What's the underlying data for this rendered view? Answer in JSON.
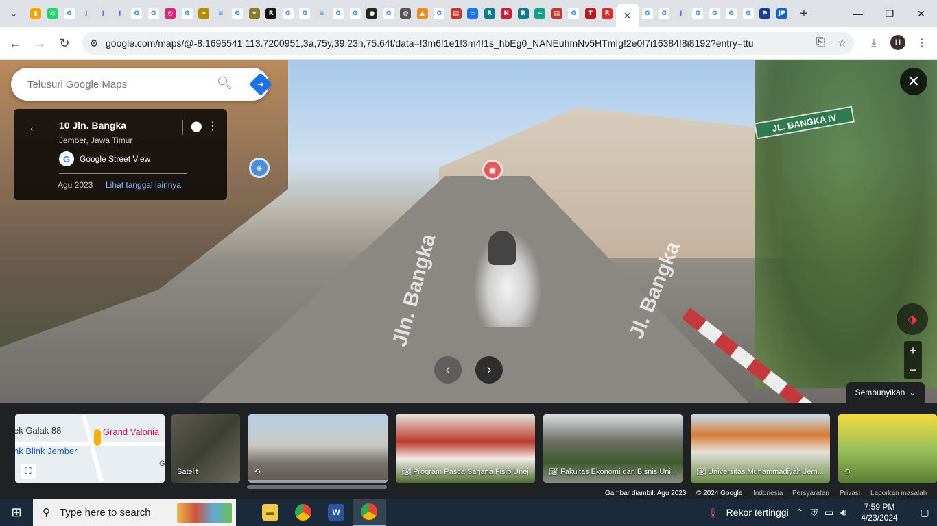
{
  "browser": {
    "active_tab_close": "✕",
    "new_tab": "+",
    "url": "google.com/maps/@-8.1695541,113.7200951,3a,75y,39.23h,75.64t/data=!3m6!1e1!3m4!1s_hbEg0_NANEuhmNv5HTmIg!2e0!7i16384!8i8192?entry=ttu",
    "profile_initial": "H",
    "tabs": [
      {
        "icon": "chart-favicon",
        "color": "#f4a300",
        "glyph": "▮"
      },
      {
        "icon": "whatsapp-favicon",
        "color": "#25d366",
        "glyph": "☏"
      },
      {
        "icon": "google-favicon",
        "color": "#ffffff",
        "glyph": "G"
      },
      {
        "icon": "jdih-favicon",
        "color": "#e0e0e0",
        "glyph": "J"
      },
      {
        "icon": "jdih-favicon",
        "color": "#e0e0e0",
        "glyph": "J"
      },
      {
        "icon": "jdih-favicon",
        "color": "#e0e0e0",
        "glyph": "J"
      },
      {
        "icon": "google-favicon",
        "color": "#ffffff",
        "glyph": "G"
      },
      {
        "icon": "google-favicon",
        "color": "#ffffff",
        "glyph": "G"
      },
      {
        "icon": "instagram-favicon",
        "color": "#d62976",
        "glyph": "◎"
      },
      {
        "icon": "google-favicon",
        "color": "#ffffff",
        "glyph": "G"
      },
      {
        "icon": "emblem-favicon",
        "color": "#b58b00",
        "glyph": "✦"
      },
      {
        "icon": "doc-favicon",
        "color": "#e0e0e0",
        "glyph": "≡"
      },
      {
        "icon": "google-favicon",
        "color": "#ffffff",
        "glyph": "G"
      },
      {
        "icon": "emblem-favicon",
        "color": "#8a7a2a",
        "glyph": "✦"
      },
      {
        "icon": "ro-favicon",
        "color": "#111111",
        "glyph": "R"
      },
      {
        "icon": "google-favicon",
        "color": "#ffffff",
        "glyph": "G"
      },
      {
        "icon": "google-favicon",
        "color": "#ffffff",
        "glyph": "G"
      },
      {
        "icon": "doc-favicon",
        "color": "#e0e0e0",
        "glyph": "≡"
      },
      {
        "icon": "google-favicon",
        "color": "#ffffff",
        "glyph": "G"
      },
      {
        "icon": "google-favicon",
        "color": "#ffffff",
        "glyph": "G"
      },
      {
        "icon": "red-circle-favicon",
        "color": "#222222",
        "glyph": "●"
      },
      {
        "icon": "google-favicon",
        "color": "#ffffff",
        "glyph": "G"
      },
      {
        "icon": "globe-favicon",
        "color": "#555555",
        "glyph": "◍"
      },
      {
        "icon": "orange-favicon",
        "color": "#f08c1e",
        "glyph": "▲"
      },
      {
        "icon": "google-favicon",
        "color": "#ffffff",
        "glyph": "G"
      },
      {
        "icon": "book-favicon",
        "color": "#c0392b",
        "glyph": "▤"
      },
      {
        "icon": "docs-favicon",
        "color": "#1a73e8",
        "glyph": "▭"
      },
      {
        "icon": "rs-favicon",
        "color": "#0c7c8c",
        "glyph": "R"
      },
      {
        "icon": "n-favicon",
        "color": "#c41e3a",
        "glyph": "N"
      },
      {
        "icon": "rs-favicon",
        "color": "#0c7c8c",
        "glyph": "R"
      },
      {
        "icon": "wave-favicon",
        "color": "#16a085",
        "glyph": "~"
      },
      {
        "icon": "book-favicon",
        "color": "#c0392b",
        "glyph": "▤"
      },
      {
        "icon": "google-favicon",
        "color": "#ffffff",
        "glyph": "G"
      },
      {
        "icon": "ti-favicon",
        "color": "#b71c1c",
        "glyph": "T"
      },
      {
        "icon": "r-favicon",
        "color": "#d32f2f",
        "glyph": "R"
      }
    ],
    "tabs_after": [
      {
        "icon": "google-favicon",
        "color": "#ffffff",
        "glyph": "G"
      },
      {
        "icon": "google-favicon",
        "color": "#ffffff",
        "glyph": "G"
      },
      {
        "icon": "jdih-favicon",
        "color": "#e0e0e0",
        "glyph": "J"
      },
      {
        "icon": "google-favicon",
        "color": "#ffffff",
        "glyph": "G"
      },
      {
        "icon": "google-favicon",
        "color": "#ffffff",
        "glyph": "G"
      },
      {
        "icon": "google-favicon",
        "color": "#ffffff",
        "glyph": "G"
      },
      {
        "icon": "google-favicon",
        "color": "#ffffff",
        "glyph": "G"
      },
      {
        "icon": "flag-favicon",
        "color": "#1a3d8f",
        "glyph": "⚑"
      },
      {
        "icon": "jp-favicon",
        "color": "#1565c0",
        "glyph": "JP"
      }
    ]
  },
  "maps": {
    "search_placeholder": "Telusuri Google Maps",
    "card": {
      "title": "10 Jln. Bangka",
      "subtitle": "Jember, Jawa Timur",
      "source": "Google Street View",
      "date": "Agu 2023",
      "more_dates": "Lihat tanggal lainnya"
    },
    "scene": {
      "sign_text": "JL. BANGKA IV",
      "road_label_1": "Jln. Bangka",
      "road_label_2": "Jl. Bangka"
    },
    "hide_label": "Sembunyikan",
    "filmstrip": {
      "map_labels": [
        "ek Galak 88",
        "Grand Valonia",
        "nk Blink Jember",
        "G"
      ],
      "satellite_label": "Satelit",
      "photos": [
        "",
        "Program Pasca Sarjana Fisip Unej",
        "Fakultas Ekonomi dan Bisnis Uni...",
        "Universitas Muhammadiyah Jem..."
      ]
    },
    "footer": {
      "captured": "Gambar diambil: Agu 2023",
      "copyright": "© 2024 Google",
      "region": "Indonesia",
      "terms": "Persyaratan",
      "privacy": "Privasi",
      "report": "Laporkan masalah"
    }
  },
  "taskbar": {
    "search_placeholder": "Type here to search",
    "weather": "Rekor tertinggi",
    "time": "7:59 PM",
    "date": "4/23/2024"
  }
}
